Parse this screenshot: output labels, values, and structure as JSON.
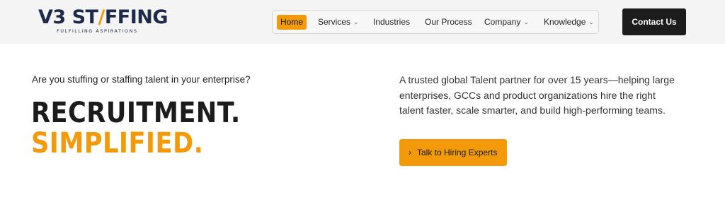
{
  "brand": {
    "logo_part1": "V3 ST",
    "logo_accent": "/",
    "logo_part2": "FFING",
    "tagline": "FULFILLING ASPIRATIONS"
  },
  "nav": {
    "items": [
      {
        "label": "Home",
        "active": true,
        "has_dropdown": false
      },
      {
        "label": "Services",
        "active": false,
        "has_dropdown": true
      },
      {
        "label": "Industries",
        "active": false,
        "has_dropdown": false
      },
      {
        "label": "Our Process",
        "active": false,
        "has_dropdown": false
      },
      {
        "label": "Company",
        "active": false,
        "has_dropdown": true
      },
      {
        "label": "Knowledge",
        "active": false,
        "has_dropdown": true
      }
    ],
    "dropdown_icon": "chevron-down-icon"
  },
  "header": {
    "contact_label": "Contact Us"
  },
  "hero": {
    "question": "Are you stuffing or staffing talent in your enterprise?",
    "headline_line1": "RECRUITMENT.",
    "headline_line2": "SIMPLIFIED.",
    "description": "A trusted global Talent partner for over 15 years—helping large enterprises, GCCs and product organizations hire the right talent faster, scale smarter, and build high-performing teams.",
    "cta_label": "Talk to Hiring Experts",
    "cta_icon": "chevron-right-icon"
  },
  "colors": {
    "accent": "#f29a0a",
    "dark": "#1c1c1c",
    "brand_navy": "#1e2a4a"
  }
}
